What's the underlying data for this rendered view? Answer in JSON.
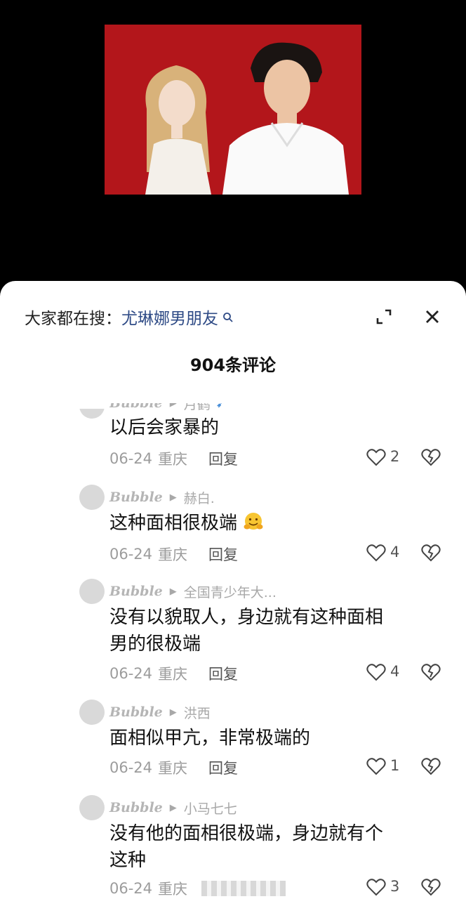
{
  "search": {
    "prefix": "大家都在搜：",
    "term": "尤琳娜男朋友"
  },
  "header": {
    "comment_count_title": "904条评论"
  },
  "icons": {
    "expand": "expand-icon",
    "close": "close-icon",
    "like": "heart-icon",
    "dislike": "broken-heart-icon"
  },
  "colors": {
    "photo_background": "#b3161b",
    "search_term": "#2f4b86"
  },
  "comments": [
    {
      "user": "Bubble",
      "reply_to": "月鹤",
      "text_lines": [
        "以后会家暴的"
      ],
      "date": "06-24",
      "location": "重庆",
      "reply_label": "回复",
      "likes": "2"
    },
    {
      "user": "Bubble",
      "reply_to": "赫白.",
      "text_lines": [
        "这种面相很极端"
      ],
      "date": "06-24",
      "location": "重庆",
      "reply_label": "回复",
      "likes": "4"
    },
    {
      "user": "Bubble",
      "reply_to": "全国青少年大...",
      "text_lines": [
        "没有以貌取人，身边就有这种面相",
        "男的很极端"
      ],
      "date": "06-24",
      "location": "重庆",
      "reply_label": "回复",
      "likes": "4"
    },
    {
      "user": "Bubble",
      "reply_to": "洪西",
      "text_lines": [
        "面相似甲亢，非常极端的"
      ],
      "date": "06-24",
      "location": "重庆",
      "reply_label": "回复",
      "likes": "1"
    },
    {
      "user": "Bubble",
      "reply_to": "小马七七",
      "text_lines": [
        "没有他的面相很极端，身边就有个",
        "这种"
      ],
      "date": "06-24",
      "location": "重庆",
      "reply_label": "",
      "likes": "3"
    }
  ]
}
